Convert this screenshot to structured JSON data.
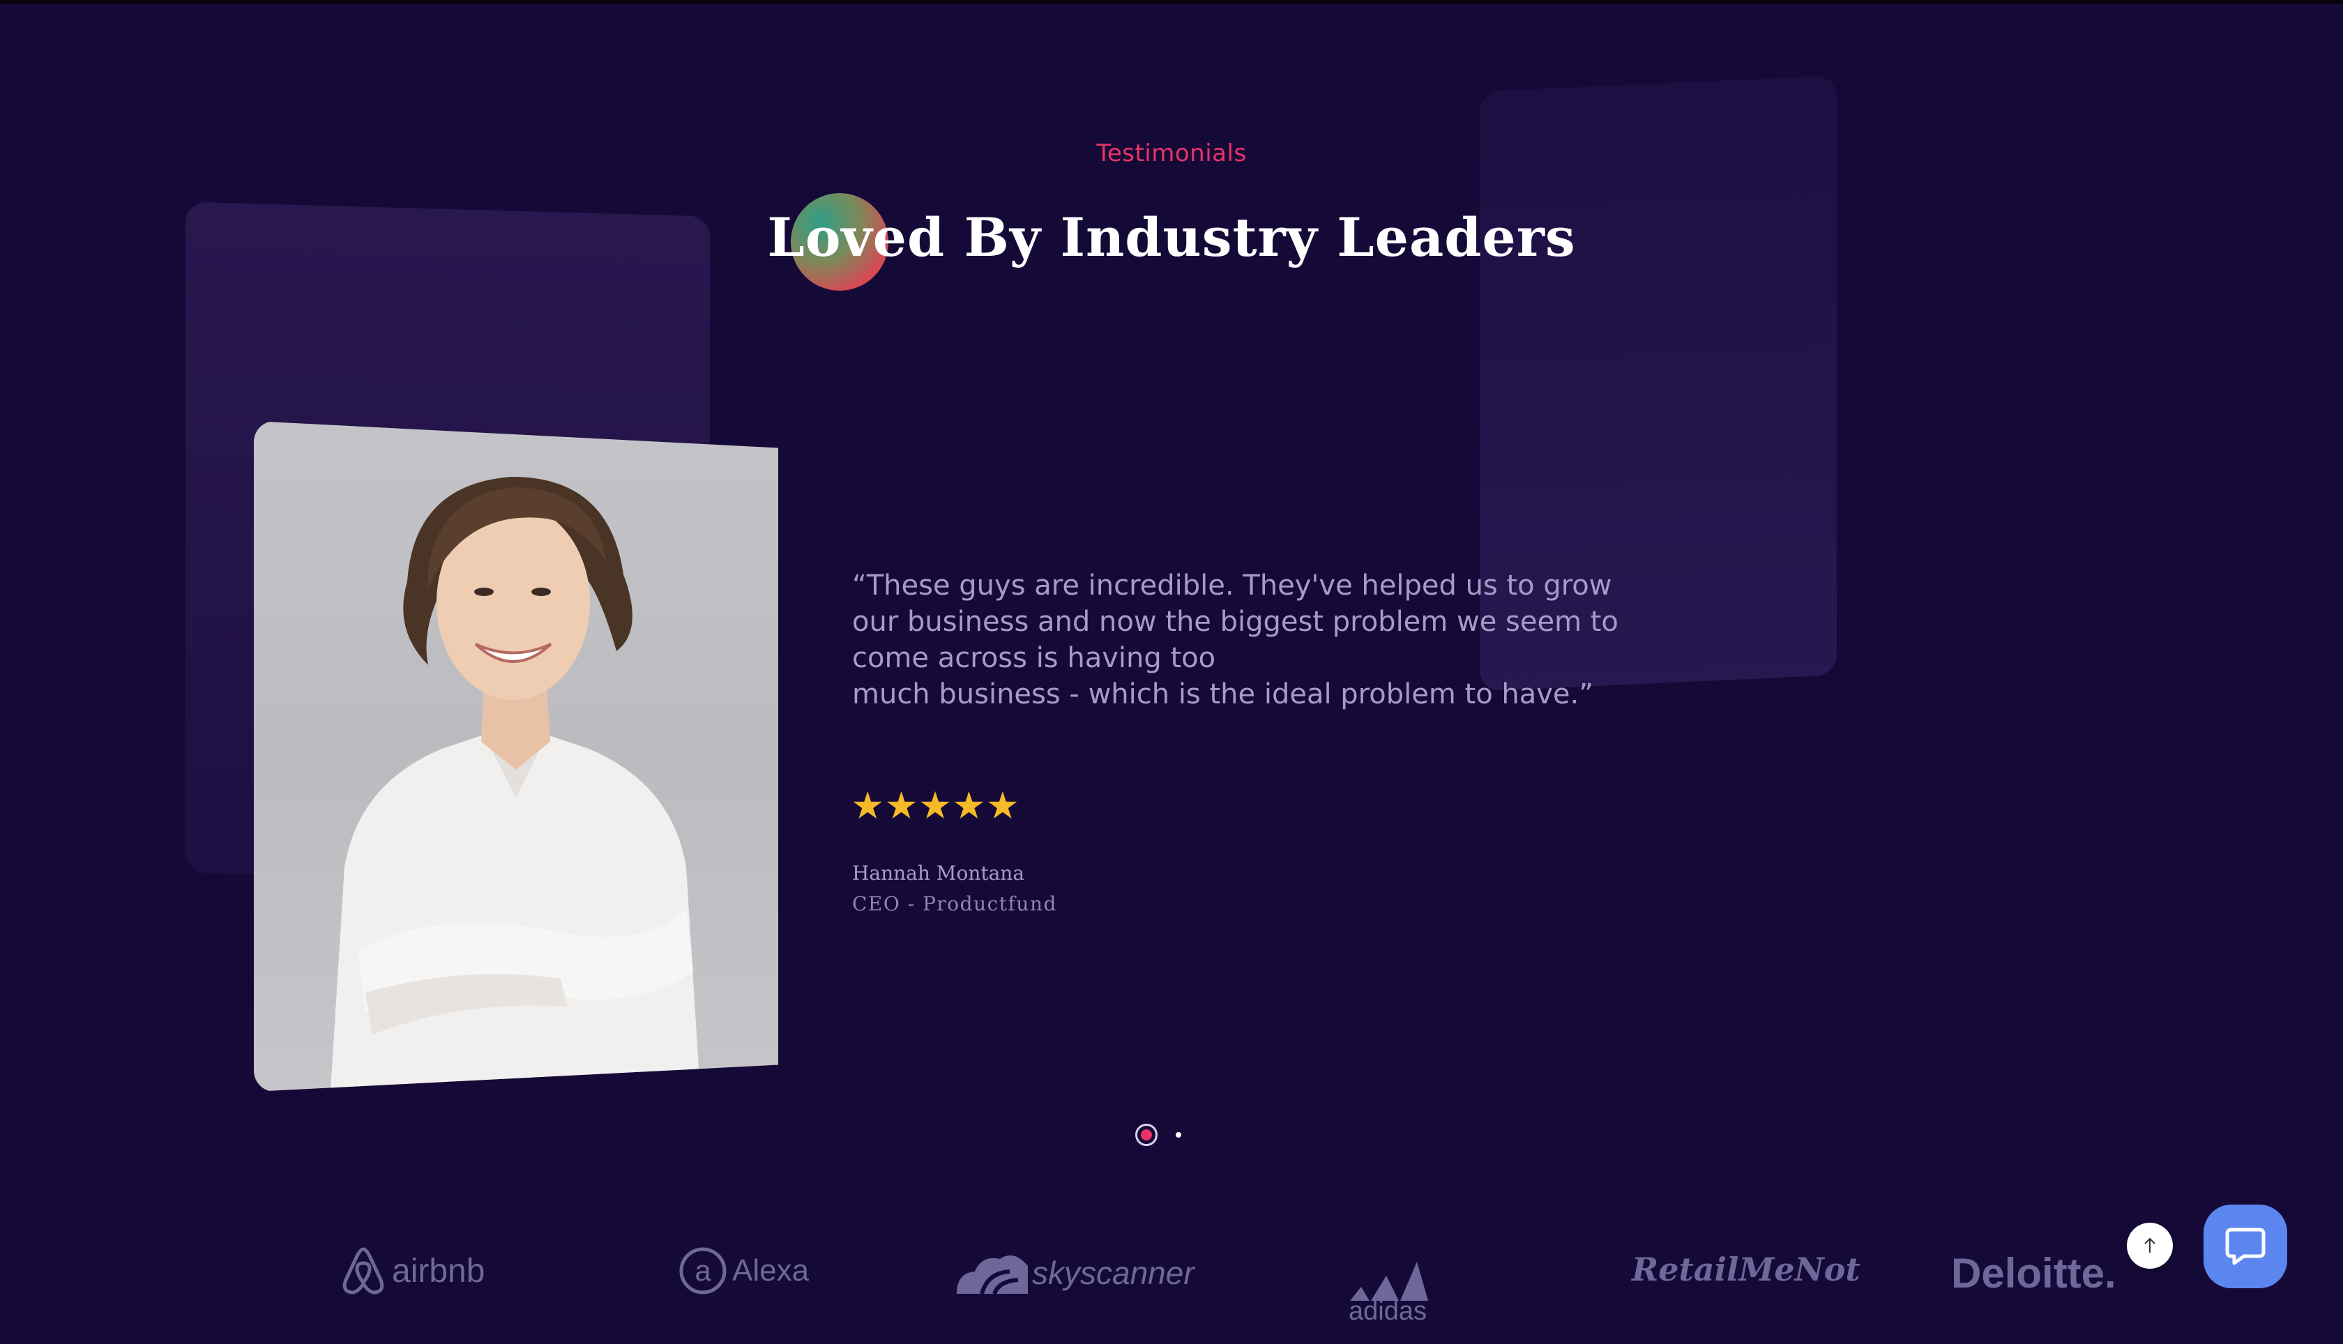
{
  "section": {
    "eyebrow": "Testimonials",
    "heading": "Loved By Industry Leaders"
  },
  "testimonial": {
    "quote": "“These guys are incredible. They've helped us to grow\nour business and now the biggest problem we seem to\ncome across is having too\nmuch business - which is the ideal problem to have.”",
    "rating": 5,
    "stars": "★★★★★",
    "author": "Hannah Montana",
    "role": "CEO - Productfund"
  },
  "carousel": {
    "active_index": 0,
    "count": 2
  },
  "logos": [
    {
      "name": "airbnb",
      "label": "airbnb"
    },
    {
      "name": "alexa",
      "label": "Alexa"
    },
    {
      "name": "skyscanner",
      "label": "skyscanner"
    },
    {
      "name": "adidas",
      "label": "adidas"
    },
    {
      "name": "retailmenot",
      "label": "RetailMeNot"
    },
    {
      "name": "deloitte",
      "label": "Deloitte."
    }
  ],
  "colors": {
    "background": "#150a37",
    "accent": "#e8336a",
    "star": "#f6b928",
    "logo": "#6d6899",
    "chat_button": "#5b86f0"
  },
  "icons": {
    "back_to_top": "arrow-up-icon",
    "chat": "chat-bubble-icon"
  }
}
